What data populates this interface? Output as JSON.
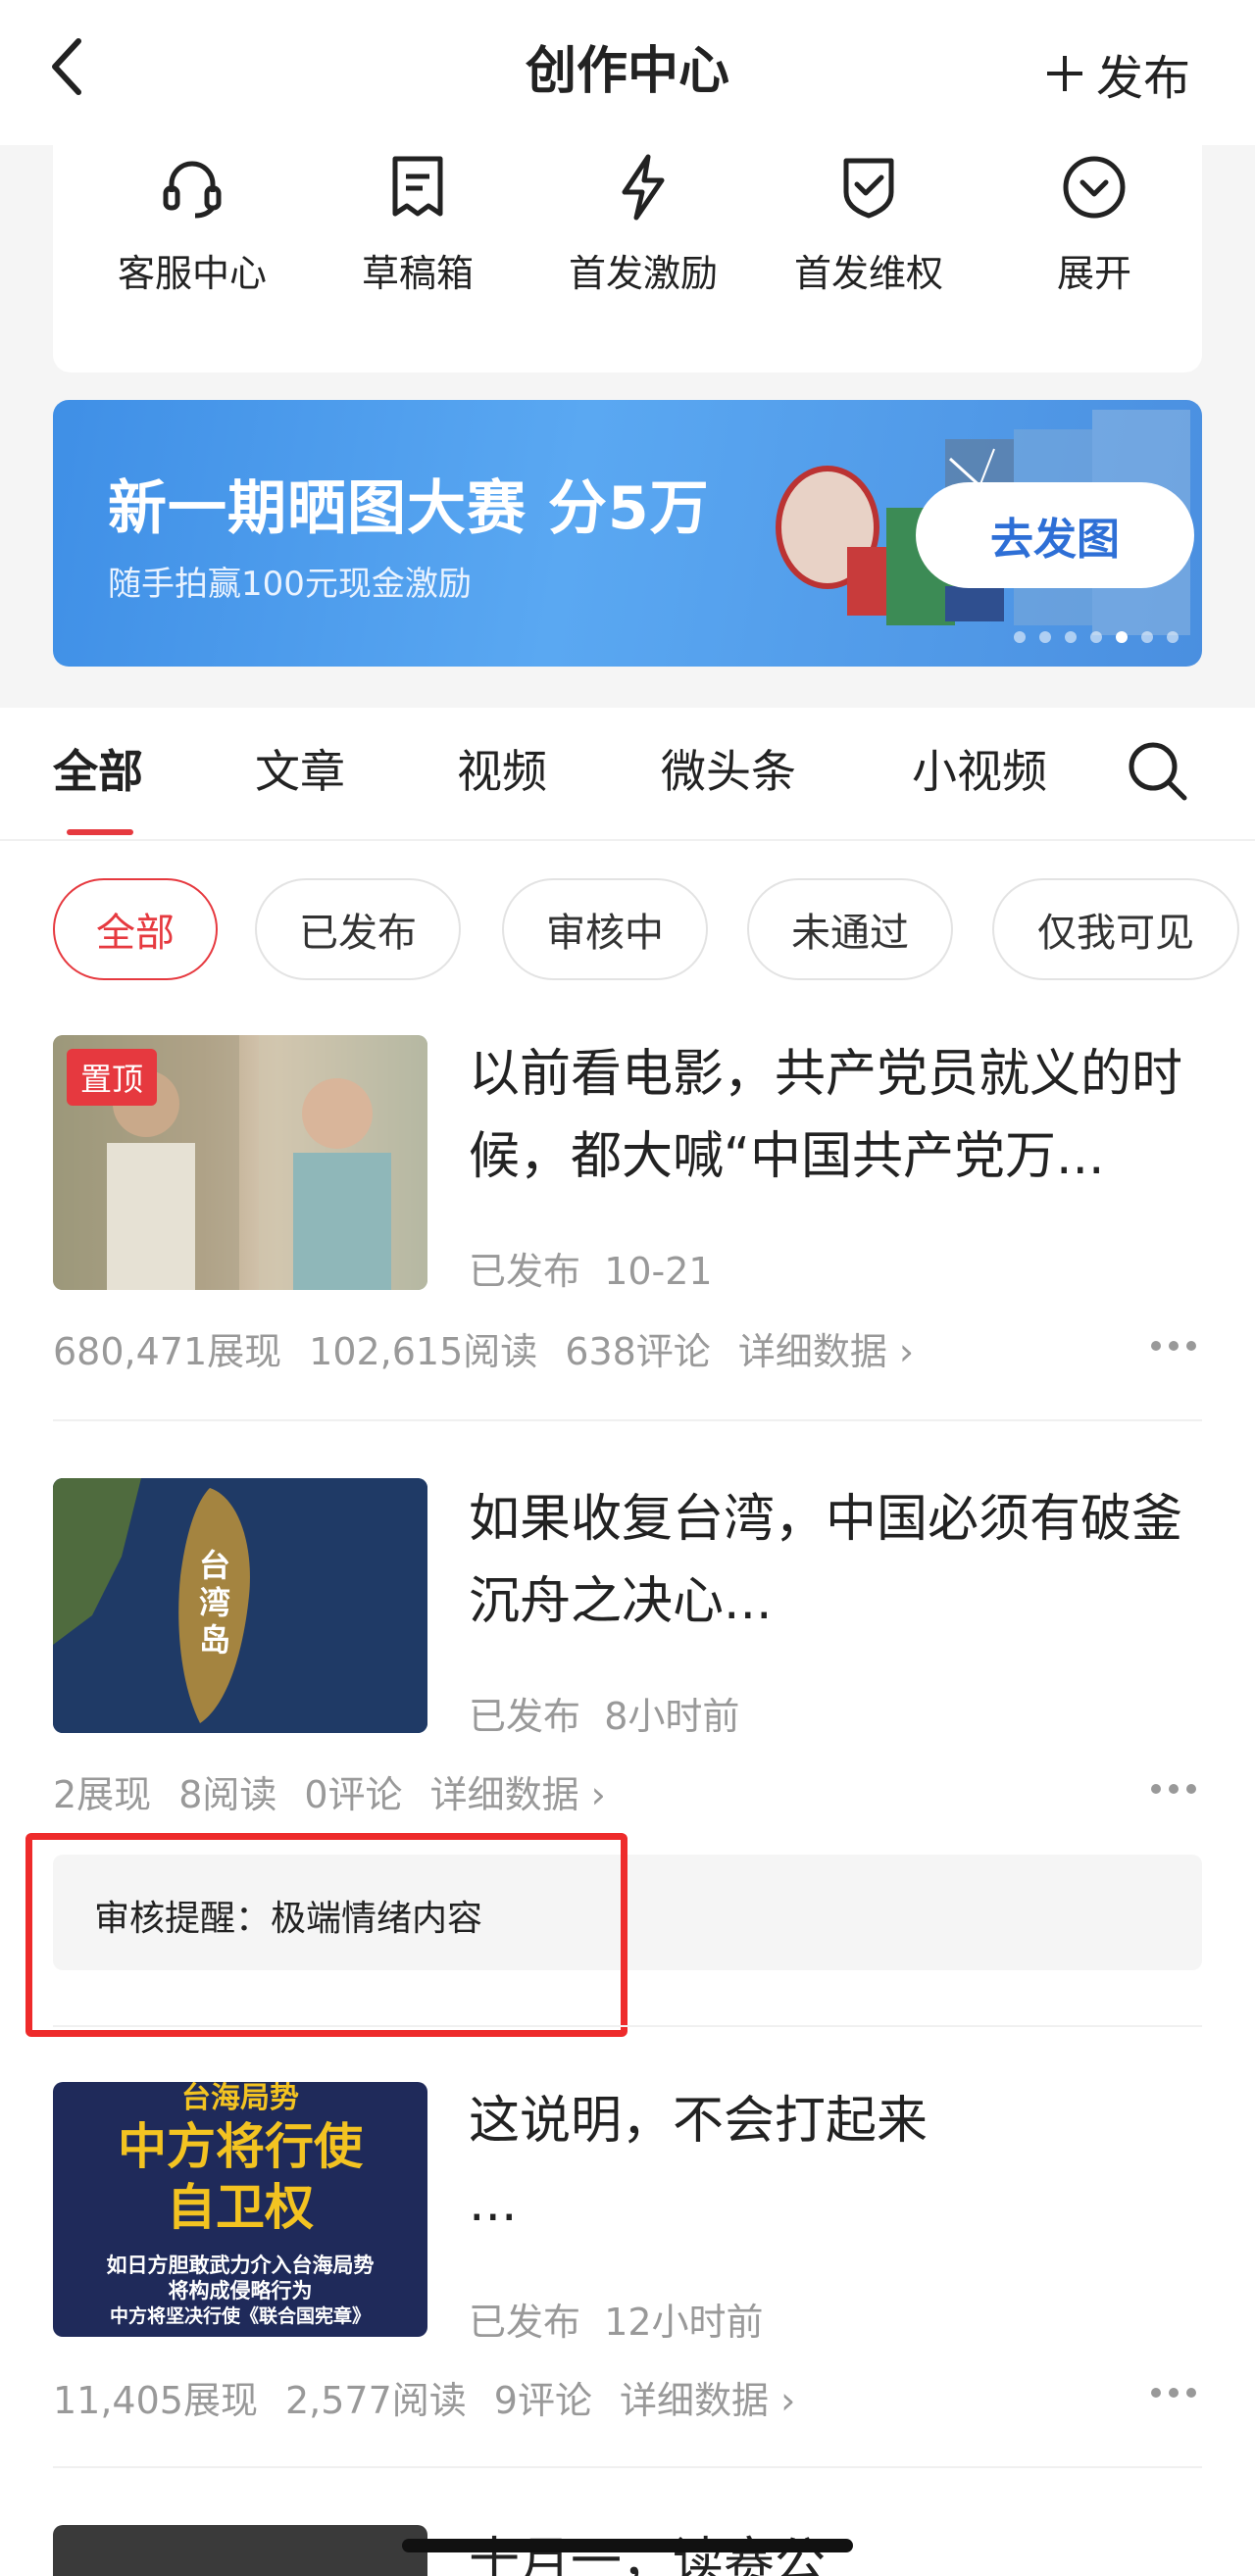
{
  "header": {
    "title": "创作中心",
    "publish_label": "发布"
  },
  "tools": [
    {
      "label": "客服中心",
      "icon": "headset-icon"
    },
    {
      "label": "草稿箱",
      "icon": "draft-icon"
    },
    {
      "label": "首发激励",
      "icon": "lightning-icon"
    },
    {
      "label": "首发维权",
      "icon": "shield-check-icon"
    },
    {
      "label": "展开",
      "icon": "chevron-down-circle-icon"
    }
  ],
  "banner": {
    "title": "新一期晒图大赛 分5万",
    "subtitle": "随手拍赢100元现金激励",
    "button": "去发图",
    "dot_count": 7,
    "active_dot": 4
  },
  "tabs": [
    "全部",
    "文章",
    "视频",
    "微头条",
    "小视频"
  ],
  "active_tab": 0,
  "filters": [
    "全部",
    "已发布",
    "审核中",
    "未通过",
    "仅我可见"
  ],
  "active_filter": 0,
  "articles": [
    {
      "badge": "置顶",
      "title": "以前看电影，共产党员就义的时候，都大喊“中国共产党万...",
      "status": "已发布",
      "time": "10-21",
      "impressions": "680,471展现",
      "reads": "102,615阅读",
      "comments": "638评论",
      "details": "详细数据"
    },
    {
      "title": "如果收复台湾，中国必须有破釜沉舟之决心...",
      "status": "已发布",
      "time": "8小时前",
      "impressions": "2展现",
      "reads": "8阅读",
      "comments": "0评论",
      "details": "详细数据",
      "thumb_text": "台湾岛",
      "review_notice": "审核提醒：极端情绪内容"
    },
    {
      "title": "这说明，不会打起来",
      "title_line2": "...",
      "status": "已发布",
      "time": "12小时前",
      "impressions": "11,405展现",
      "reads": "2,577阅读",
      "comments": "9评论",
      "details": "详细数据",
      "thumb_lines": [
        "台海局势",
        "中方将行使",
        "自卫权",
        "如日方胆敢武力介入台海局势",
        "将构成侵略行为",
        "中方将坚决行使《联合国宪章》"
      ]
    },
    {
      "title": "十月一，读赛公"
    }
  ],
  "colors": {
    "accent": "#e6393f",
    "banner_blue": "#4a94e8",
    "highlight_box": "#ee2b2b"
  }
}
